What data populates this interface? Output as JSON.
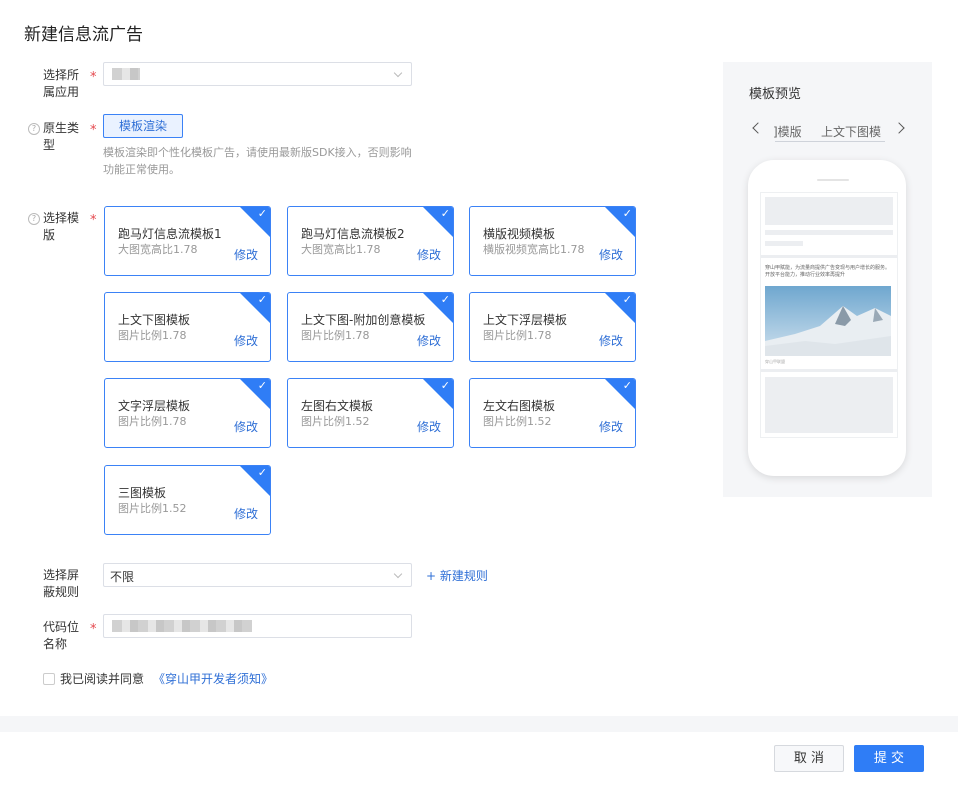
{
  "page": {
    "title": "新建信息流广告"
  },
  "app_field": {
    "label": "选择所\n属应用",
    "value": ""
  },
  "native_type": {
    "label": "原生类\n型",
    "button": "模板渲染",
    "hint": "模板渲染即个性化模板广告，请使用最新版SDK接入，否则影响功能正常使用。"
  },
  "template": {
    "label": "选择模\n版",
    "edit_label": "修改",
    "items": [
      {
        "name": "跑马灯信息流模板1",
        "sub": "大图宽高比1.78"
      },
      {
        "name": "跑马灯信息流模板2",
        "sub": "大图宽高比1.78"
      },
      {
        "name": "横版视频模板",
        "sub": "横版视频宽高比1.78"
      },
      {
        "name": "上文下图模板",
        "sub": "图片比例1.78"
      },
      {
        "name": "上文下图-附加创意模板",
        "sub": "图片比例1.78"
      },
      {
        "name": "上文下浮层模板",
        "sub": "图片比例1.78"
      },
      {
        "name": "文字浮层模板",
        "sub": "图片比例1.78"
      },
      {
        "name": "左图右文模板",
        "sub": "图片比例1.52"
      },
      {
        "name": "左文右图模板",
        "sub": "图片比例1.52"
      },
      {
        "name": "三图模板",
        "sub": "图片比例1.52"
      }
    ]
  },
  "block_rule": {
    "label": "选择屏\n蔽规则",
    "value": "不限",
    "add_label": "+ 新建规则"
  },
  "slot_name": {
    "label": "代码位\n名称",
    "value": ""
  },
  "agreement": {
    "text": "我已阅读并同意",
    "link": "《穿山甲开发者须知》"
  },
  "preview": {
    "title": "模板预览",
    "tabs": [
      "]模版",
      "上文下图模"
    ],
    "feed_text": "穿山甲赋能，为流量商提供广告变现与用户增长的服务。开放平台能力，推动行业效率再提升",
    "feed_meta": "穿山甲联盟"
  },
  "footer": {
    "cancel": "取 消",
    "submit": "提 交"
  }
}
